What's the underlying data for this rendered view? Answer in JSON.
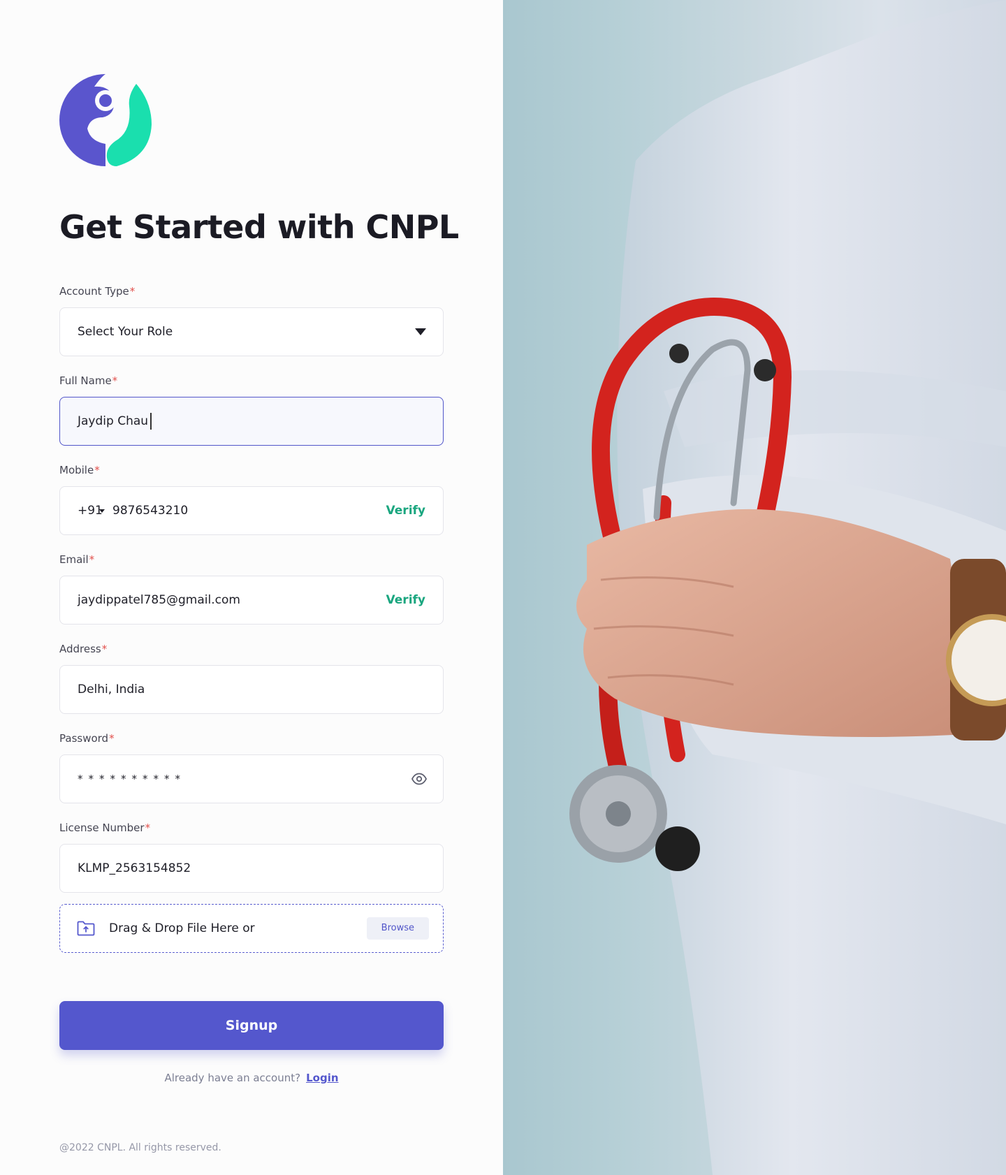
{
  "title": "Get Started with CNPL",
  "brand": {
    "name": "CNPL",
    "primary_color": "#5457CD",
    "accent_color": "#1ADFAE"
  },
  "form": {
    "account_type": {
      "label": "Account Type",
      "required_mark": "*",
      "value": "Select Your Role"
    },
    "full_name": {
      "label": "Full Name",
      "required_mark": "*",
      "value": "Jaydip Chau"
    },
    "mobile": {
      "label": "Mobile",
      "required_mark": "*",
      "country_code": "+91",
      "value": "9876543210",
      "verify_label": "Verify"
    },
    "email": {
      "label": "Email",
      "required_mark": "*",
      "value": "jaydippatel785@gmail.com",
      "verify_label": "Verify"
    },
    "address": {
      "label": "Address",
      "required_mark": "*",
      "value": "Delhi, India"
    },
    "password": {
      "label": "Password",
      "required_mark": "*",
      "masked_value": "**********"
    },
    "license_number": {
      "label": "License Number",
      "required_mark": "*",
      "value": "KLMP_2563154852"
    },
    "upload": {
      "text": "Drag & Drop File Here or",
      "browse_label": "Browse"
    }
  },
  "signup_label": "Signup",
  "login_prompt": {
    "text": "Already have an account?",
    "link_label": "Login"
  },
  "footer": "@2022 CNPL. All rights reserved."
}
